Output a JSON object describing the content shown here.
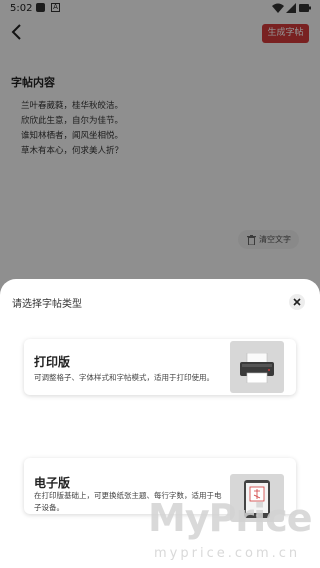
{
  "status_bar": {
    "time": "5:02",
    "notif_glyph": "A"
  },
  "header": {
    "generate_label": "生成字帖"
  },
  "content": {
    "title": "字帖内容",
    "poem_lines": [
      "兰叶春葳蕤，桂华秋皎洁。",
      "欣欣此生意，自尔为佳节。",
      "谁知林栖者，闻风坐相悦。",
      "草木有本心，何求美人折？"
    ],
    "clear_label": "清空文字"
  },
  "sheet": {
    "title": "请选择字帖类型",
    "options": [
      {
        "title": "打印版",
        "description": "可调整格子、字体样式和字帖模式，适用于打印使用。",
        "thumb_icon": "printer-icon"
      },
      {
        "title": "电子版",
        "description": "在打印版基础上，可更换纸张主题、每行字数，适用于电子设备。",
        "thumb_icon": "phone-icon"
      }
    ]
  },
  "watermark": {
    "main": "MyPrice",
    "sub": "myprice.com.cn"
  },
  "colors": {
    "accent": "#d13a3a",
    "sheet_bg": "#ffffff",
    "page_bg": "#f6f6f6"
  }
}
